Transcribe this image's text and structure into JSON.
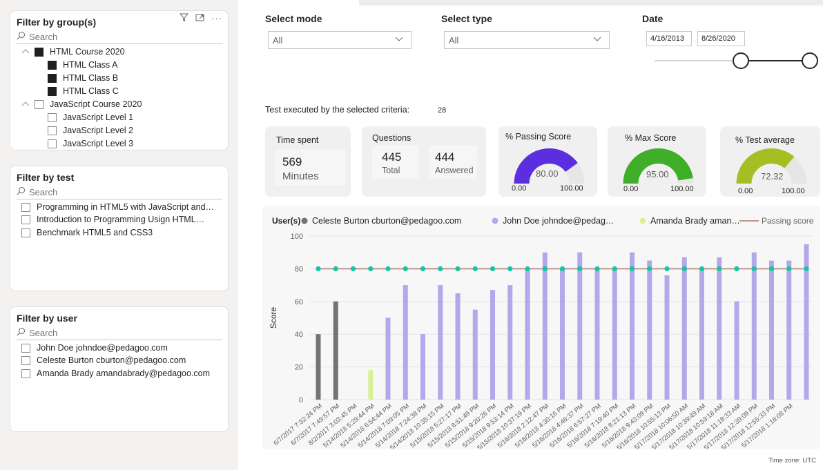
{
  "filters": {
    "group": {
      "title": "Filter by group(s)",
      "search_placeholder": "Search",
      "tree": [
        {
          "label": "HTML Course 2020",
          "checked": true,
          "children": [
            {
              "label": "HTML Class A",
              "checked": true
            },
            {
              "label": "HTML Class B",
              "checked": true
            },
            {
              "label": "HTML Class C",
              "checked": true
            }
          ]
        },
        {
          "label": "JavaScript Course 2020",
          "checked": false,
          "children": [
            {
              "label": "JavaScript Level 1",
              "checked": false
            },
            {
              "label": "JavaScript Level 2",
              "checked": false
            },
            {
              "label": "JavaScript Level 3",
              "checked": false
            }
          ]
        }
      ]
    },
    "test": {
      "title": "Filter by test",
      "search_placeholder": "Search",
      "items": [
        "Programming in HTML5 with JavaScript and…",
        "Introduction to Programming Usign HTML…",
        "Benchmark HTML5 and CSS3"
      ]
    },
    "user": {
      "title": "Filter by user",
      "search_placeholder": "Search",
      "items": [
        "John Doe johndoe@pedagoo.com",
        "Celeste Burton cburton@pedagoo.com",
        "Amanda Brady amandabrady@pedagoo.com"
      ]
    }
  },
  "controls": {
    "mode": {
      "label": "Select mode",
      "value": "All"
    },
    "type": {
      "label": "Select type",
      "value": "All"
    },
    "date": {
      "label": "Date",
      "start": "4/16/2013",
      "end": "8/26/2020"
    }
  },
  "summary": {
    "label": "Test executed by the selected criteria:",
    "count": "28"
  },
  "cards": {
    "time": {
      "title": "Time spent",
      "value": "569",
      "unit": "Minutes"
    },
    "questions": {
      "title": "Questions",
      "total": "445",
      "total_label": "Total",
      "answered": "444",
      "answered_label": "Answered"
    },
    "gauges": [
      {
        "title": "% Passing Score",
        "value": 80.0,
        "display": "80.00",
        "min": "0.00",
        "max": "100.00",
        "color": "#5b2ee0"
      },
      {
        "title": "% Max Score",
        "value": 95.0,
        "display": "95.00",
        "min": "0.00",
        "max": "100.00",
        "color": "#3fae29"
      },
      {
        "title": "% Test average",
        "value": 72.32,
        "display": "72.32",
        "min": "0.00",
        "max": "100.00",
        "color": "#a6bd23"
      }
    ]
  },
  "chart_data": {
    "type": "bar",
    "legend_title": "User(s)",
    "legend": [
      {
        "name": "Celeste Burton cburton@pedagoo.com",
        "color": "#737373",
        "kind": "dot"
      },
      {
        "name": "John Doe johndoe@pedag…",
        "color": "#b4a7ea",
        "kind": "dot"
      },
      {
        "name": "Amanda Brady aman…",
        "color": "#d7f19a",
        "kind": "dot"
      },
      {
        "name": "Passing score",
        "color": "#c1958c",
        "kind": "line"
      }
    ],
    "ylabel": "Score",
    "ylim": [
      0,
      100
    ],
    "yticks": [
      0,
      20,
      40,
      60,
      80,
      100
    ],
    "categories": [
      "6/7/2017 7:32:24 PM",
      "6/7/2017 7:49:57 PM",
      "8/2/2017 3:03:45 PM",
      "5/14/2018 5:29:44 PM",
      "5/14/2018 6:54:44 PM",
      "5/14/2018 7:09:05 PM",
      "5/14/2018 7:24:38 PM",
      "5/14/2018 10:35:15 PM",
      "5/15/2018 5:27:17 PM",
      "5/15/2018 8:51:49 PM",
      "5/15/2018 9:20:26 PM",
      "5/15/2018 9:53:14 PM",
      "5/15/2018 10:37:19 PM",
      "5/16/2018 2:12:47 PM",
      "5/16/2018 4:30:16 PM",
      "5/16/2018 4:46:37 PM",
      "5/16/2018 6:57:27 PM",
      "5/16/2018 7:19:40 PM",
      "5/16/2018 8:21:13 PM",
      "5/16/2018 9:43:09 PM",
      "5/16/2018 10:55:13 PM",
      "5/17/2018 10:06:50 AM",
      "5/17/2018 10:39:49 AM",
      "5/17/2018 10:53:18 AM",
      "5/17/2018 11:18:33 AM",
      "5/17/2018 12:39:09 PM",
      "5/17/2018 12:55:33 PM",
      "5/17/2018 1:16:08 PM"
    ],
    "values": [
      40,
      60,
      0,
      18,
      50,
      70,
      40,
      70,
      65,
      55,
      67,
      70,
      80,
      90,
      80,
      90,
      80,
      80,
      90,
      85,
      76,
      87,
      80,
      87,
      60,
      90,
      85,
      85,
      95
    ],
    "users": [
      0,
      0,
      0,
      2,
      1,
      1,
      1,
      1,
      1,
      1,
      1,
      1,
      1,
      1,
      1,
      1,
      1,
      1,
      1,
      1,
      1,
      1,
      1,
      1,
      1,
      1,
      1,
      1,
      1
    ],
    "passing_score": 80
  },
  "footer": "Time zone: UTC"
}
